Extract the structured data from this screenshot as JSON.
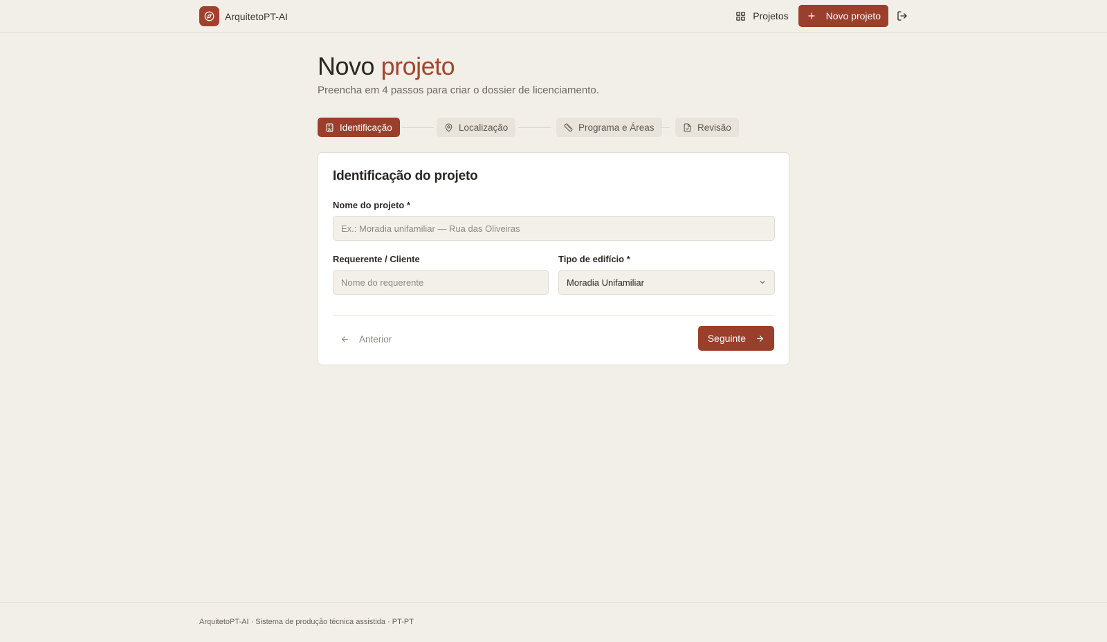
{
  "header": {
    "brand_name": "ArquitetoPT-AI",
    "nav_projects": "Projetos",
    "new_project_button": "Novo projeto"
  },
  "page": {
    "title_part1": "Novo",
    "title_part2": "projeto",
    "subtitle": "Preencha em 4 passos para criar o dossier de licenciamento."
  },
  "steps": [
    {
      "label": "Identificação",
      "icon": "building-icon",
      "active": true
    },
    {
      "label": "Localização",
      "icon": "map-pin-icon",
      "active": false
    },
    {
      "label": "Programa e Áreas",
      "icon": "ruler-icon",
      "active": false
    },
    {
      "label": "Revisão",
      "icon": "file-check-icon",
      "active": false
    }
  ],
  "form": {
    "section_title": "Identificação do projeto",
    "project_name_label": "Nome do projeto *",
    "project_name_placeholder": "Ex.: Moradia unifamiliar — Rua das Oliveiras",
    "project_name_value": "",
    "client_label": "Requerente / Cliente",
    "client_placeholder": "Nome do requerente",
    "client_value": "",
    "building_type_label": "Tipo de edifício *",
    "building_type_value": "Moradia Unifamiliar",
    "prev_button": "Anterior",
    "next_button": "Seguinte"
  },
  "footer": {
    "text": "ArquitetoPT-AI · Sistema de produção técnica assistida · PT-PT"
  },
  "colors": {
    "accent": "#9a3f2c",
    "background": "#f2efe8"
  }
}
